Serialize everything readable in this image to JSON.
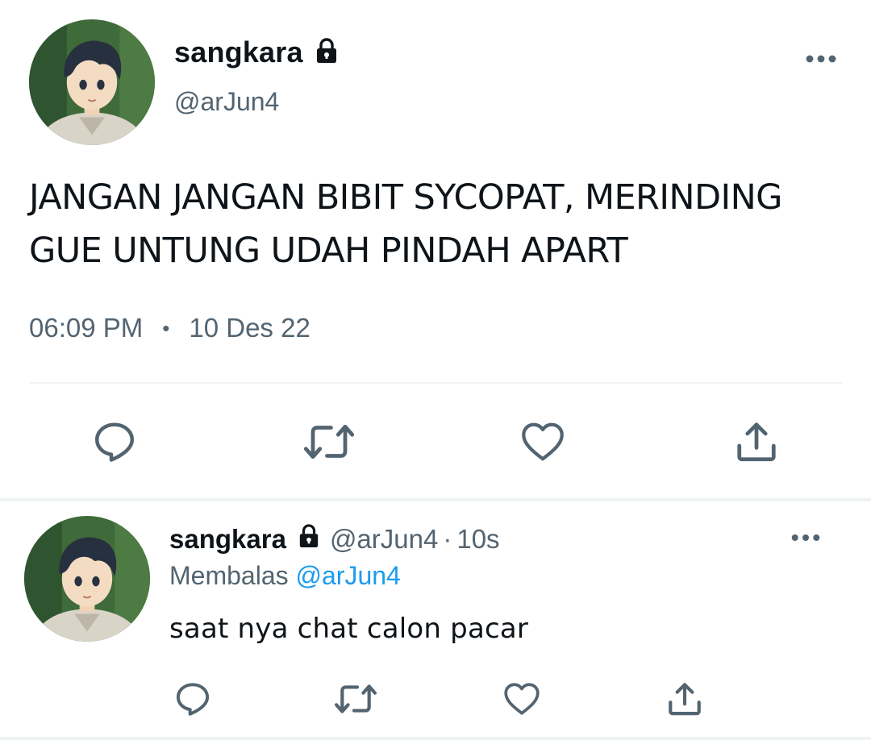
{
  "main_tweet": {
    "display_name": "sangkara",
    "handle": "@arJun4",
    "text": "JANGAN JANGAN BIBIT SYCOPAT, MERINDING\nGUE UNTUNG UDAH PINDAH APART",
    "time": "06:09 PM",
    "separator": "•",
    "date": "10 Des 22"
  },
  "reply_tweet": {
    "display_name": "sangkara",
    "handle": "@arJun4",
    "separator": "·",
    "time_ago": "10s",
    "replying_prefix": "Membalas",
    "replying_mention": "@arJun4",
    "text": "saat nya chat calon pacar"
  },
  "icons": {
    "lock": "lock-icon",
    "more": "more-horizontal-icon",
    "reply": "reply-bubble-icon",
    "retweet": "retweet-icon",
    "like": "heart-icon",
    "share": "share-upload-icon"
  },
  "colors": {
    "text_primary": "#0f1419",
    "text_secondary": "#536471",
    "link": "#1d9bf0",
    "divider": "#eff3f4"
  }
}
